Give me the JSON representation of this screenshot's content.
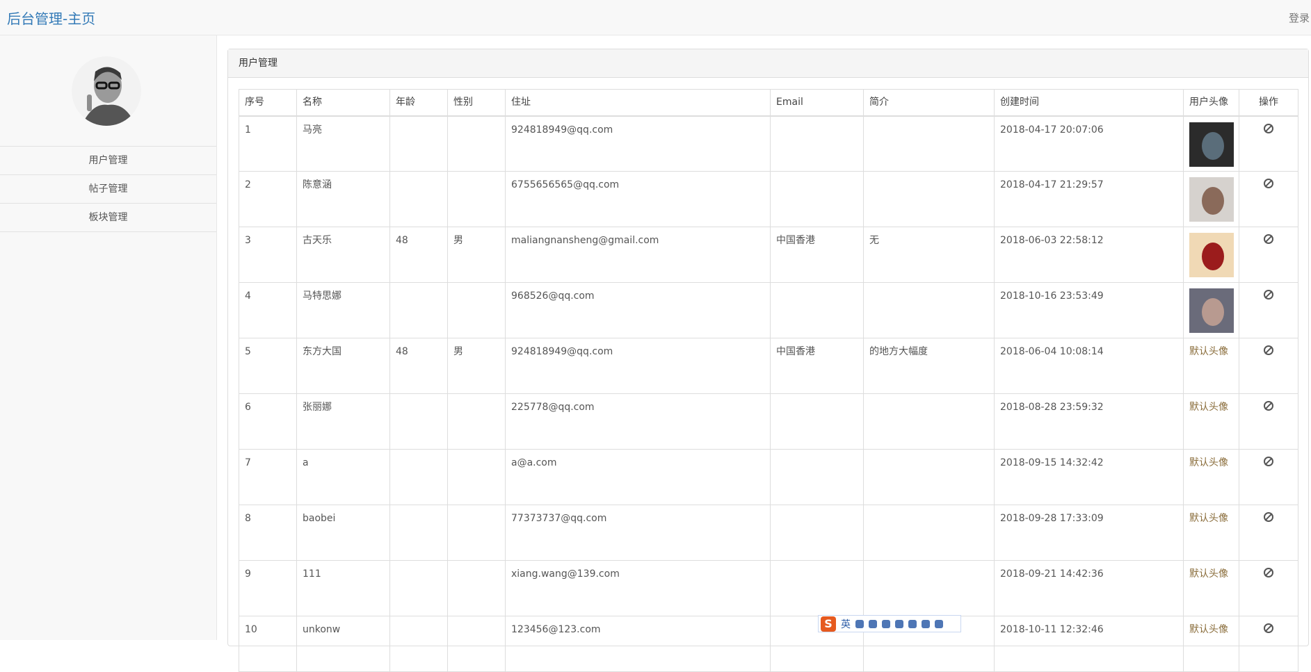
{
  "navbar": {
    "brand": "后台管理-主页",
    "login": "登录"
  },
  "sidebar": {
    "items": [
      {
        "label": "用户管理"
      },
      {
        "label": "帖子管理"
      },
      {
        "label": "板块管理"
      }
    ]
  },
  "panel": {
    "title": "用户管理"
  },
  "table": {
    "headers": [
      "序号",
      "名称",
      "年龄",
      "性别",
      "住址",
      "Email",
      "简介",
      "创建时间",
      "用户头像",
      "操作"
    ],
    "rows": [
      {
        "id": "1",
        "name": "马亮",
        "age": "",
        "gender": "",
        "address": "924818949@qq.com",
        "email": "",
        "intro": "",
        "created": "2018-04-17 20:07:06",
        "avatar": "image"
      },
      {
        "id": "2",
        "name": "陈意涵",
        "age": "",
        "gender": "",
        "address": "6755656565@qq.com",
        "email": "",
        "intro": "",
        "created": "2018-04-17 21:29:57",
        "avatar": "image"
      },
      {
        "id": "3",
        "name": "古天乐",
        "age": "48",
        "gender": "男",
        "address": "maliangnansheng@gmail.com",
        "email": "中国香港",
        "intro": "无",
        "created": "2018-06-03 22:58:12",
        "avatar": "image"
      },
      {
        "id": "4",
        "name": "马特思娜",
        "age": "",
        "gender": "",
        "address": "968526@qq.com",
        "email": "",
        "intro": "",
        "created": "2018-10-16 23:53:49",
        "avatar": "image"
      },
      {
        "id": "5",
        "name": "东方大国",
        "age": "48",
        "gender": "男",
        "address": "924818949@qq.com",
        "email": "中国香港",
        "intro": "的地方大幅度",
        "created": "2018-06-04 10:08:14",
        "avatar": "默认头像"
      },
      {
        "id": "6",
        "name": "张丽娜",
        "age": "",
        "gender": "",
        "address": "225778@qq.com",
        "email": "",
        "intro": "",
        "created": "2018-08-28 23:59:32",
        "avatar": "默认头像"
      },
      {
        "id": "7",
        "name": "a",
        "age": "",
        "gender": "",
        "address": "a@a.com",
        "email": "",
        "intro": "",
        "created": "2018-09-15 14:32:42",
        "avatar": "默认头像"
      },
      {
        "id": "8",
        "name": "baobei",
        "age": "",
        "gender": "",
        "address": "77373737@qq.com",
        "email": "",
        "intro": "",
        "created": "2018-09-28 17:33:09",
        "avatar": "默认头像"
      },
      {
        "id": "9",
        "name": "111",
        "age": "",
        "gender": "",
        "address": "xiang.wang@139.com",
        "email": "",
        "intro": "",
        "created": "2018-09-21 14:42:36",
        "avatar": "默认头像"
      },
      {
        "id": "10",
        "name": "unkonw",
        "age": "",
        "gender": "",
        "address": "123456@123.com",
        "email": "",
        "intro": "",
        "created": "2018-10-11 12:32:46",
        "avatar": "默认头像"
      }
    ]
  },
  "ime": {
    "logo": "S",
    "mode": "英"
  }
}
